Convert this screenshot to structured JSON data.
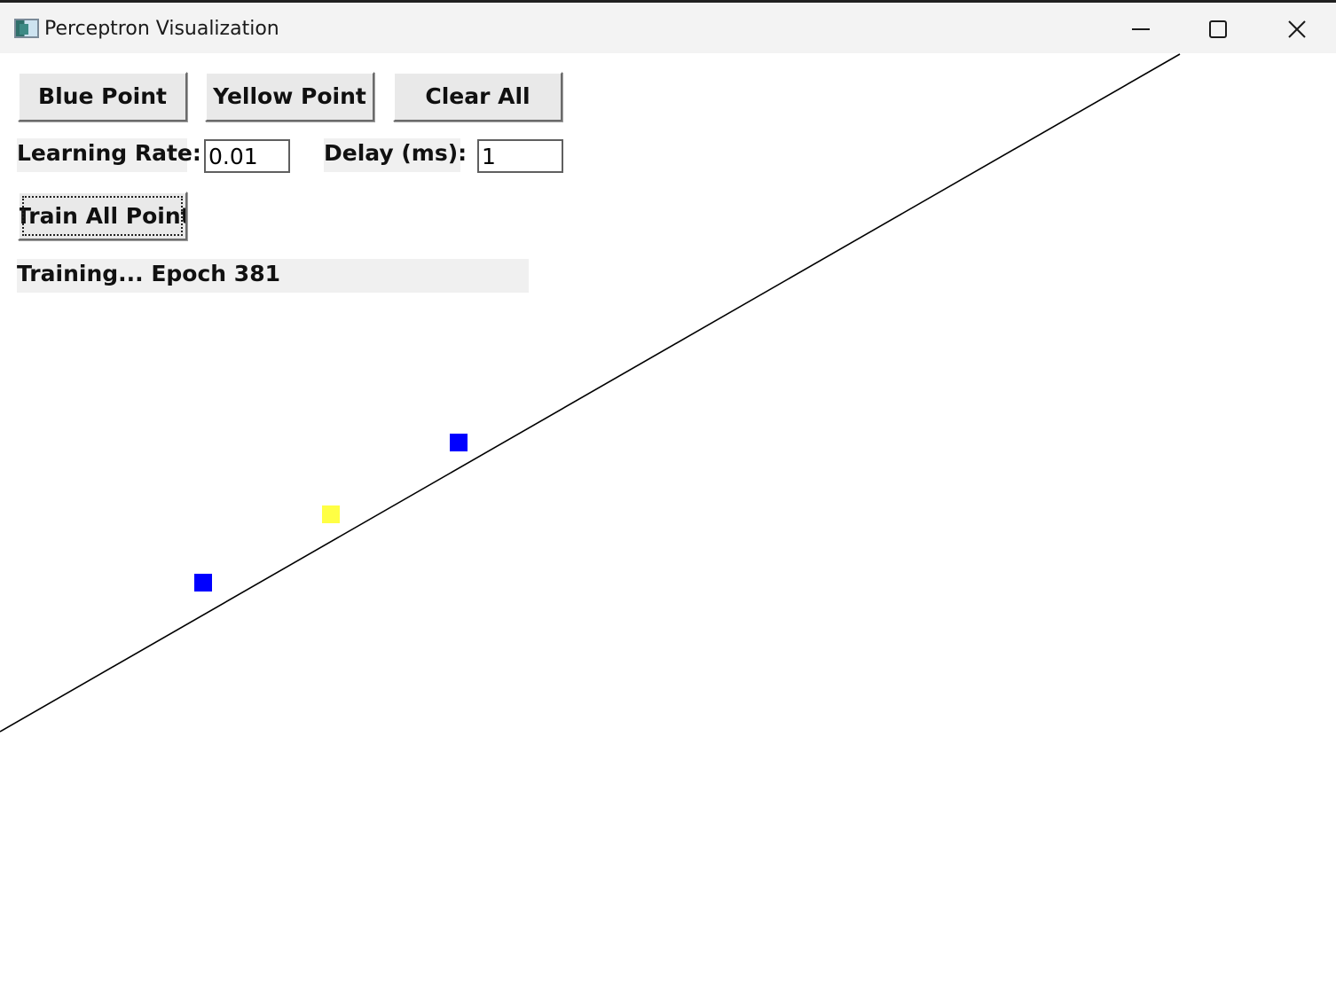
{
  "window": {
    "title": "Perceptron Visualization",
    "icons": {
      "app": "app-icon",
      "minimize": "minimize-icon",
      "maximize": "maximize-icon",
      "close": "close-icon"
    }
  },
  "controls": {
    "blue_point_label": "Blue Point",
    "yellow_point_label": "Yellow Point",
    "clear_all_label": "Clear All",
    "learning_rate_label": "Learning Rate:",
    "learning_rate_value": "0.01",
    "delay_label": "Delay (ms):",
    "delay_value": "1",
    "train_all_label": "Train All Points"
  },
  "status": {
    "text": "Training... Epoch 381"
  },
  "colors": {
    "blue_point": "#0000ff",
    "yellow_point": "#ffff44",
    "decision_line": "#000000"
  }
}
